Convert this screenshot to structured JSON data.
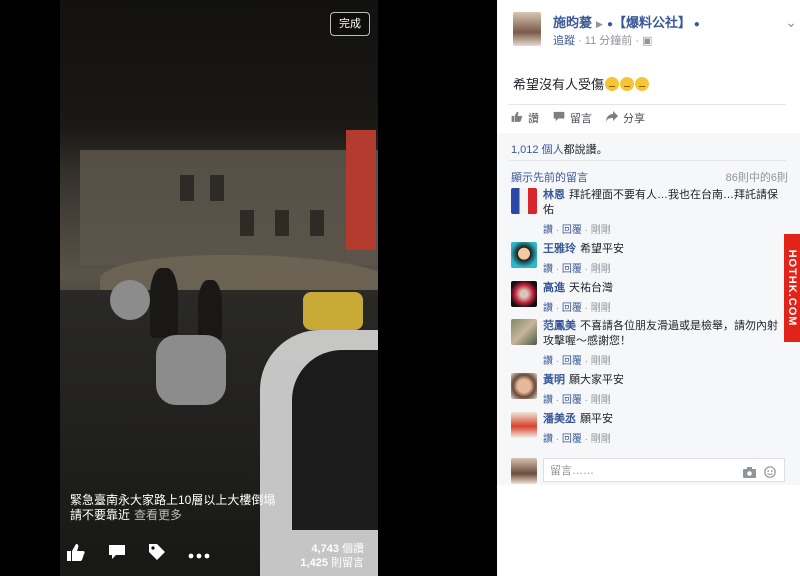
{
  "video": {
    "done_label": "完成",
    "caption_line1": "緊急臺南永大家路上10層以上大樓倒塌",
    "caption_line2": "請不要靠近",
    "see_more": "查看更多",
    "action_icons": [
      "like-icon",
      "comment-icon",
      "tag-icon",
      "more-icon"
    ],
    "views": "4,743",
    "views_label": "個讚",
    "comments_count": "1,425",
    "comments_label": "則留言"
  },
  "post": {
    "author": "施昀萲",
    "page": "【爆料公社】",
    "follow": "追蹤",
    "time": "11 分鐘前",
    "text": "希望沒有人受傷",
    "actions": {
      "like": "讚",
      "comment": "留言",
      "share": "分享"
    },
    "likes_count": "1,012 個人",
    "likes_suffix": "都說讚。",
    "show_previous": "顯示先前的留言",
    "comment_count": "86則中的6則"
  },
  "comments": [
    {
      "name": "林恩",
      "text": "拜託裡面不要有人…我也在台南…拜託請保佑",
      "like": "讚",
      "reply": "回覆",
      "time": "剛剛"
    },
    {
      "name": "王雅玲",
      "text": "希望平安",
      "like": "讚",
      "reply": "回覆",
      "time": "剛剛"
    },
    {
      "name": "高進",
      "text": "天祐台灣",
      "like": "讚",
      "reply": "回覆",
      "time": "剛剛"
    },
    {
      "name": "范鳳美",
      "text": "不喜請各位朋友滑過或是檢舉，請勿內射攻擊喔～感謝您！",
      "like": "讚",
      "reply": "回覆",
      "time": "剛剛"
    },
    {
      "name": "黃明",
      "text": "願大家平安",
      "like": "讚",
      "reply": "回覆",
      "time": "剛剛"
    },
    {
      "name": "潘美丞",
      "text": "願平安",
      "like": "讚",
      "reply": "回覆",
      "time": "剛剛"
    }
  ],
  "comment_box": {
    "placeholder": "留言……"
  },
  "watermark": "HOTHK.COM",
  "colors": {
    "link": "#3b5998",
    "watermark": "#e2231a"
  }
}
